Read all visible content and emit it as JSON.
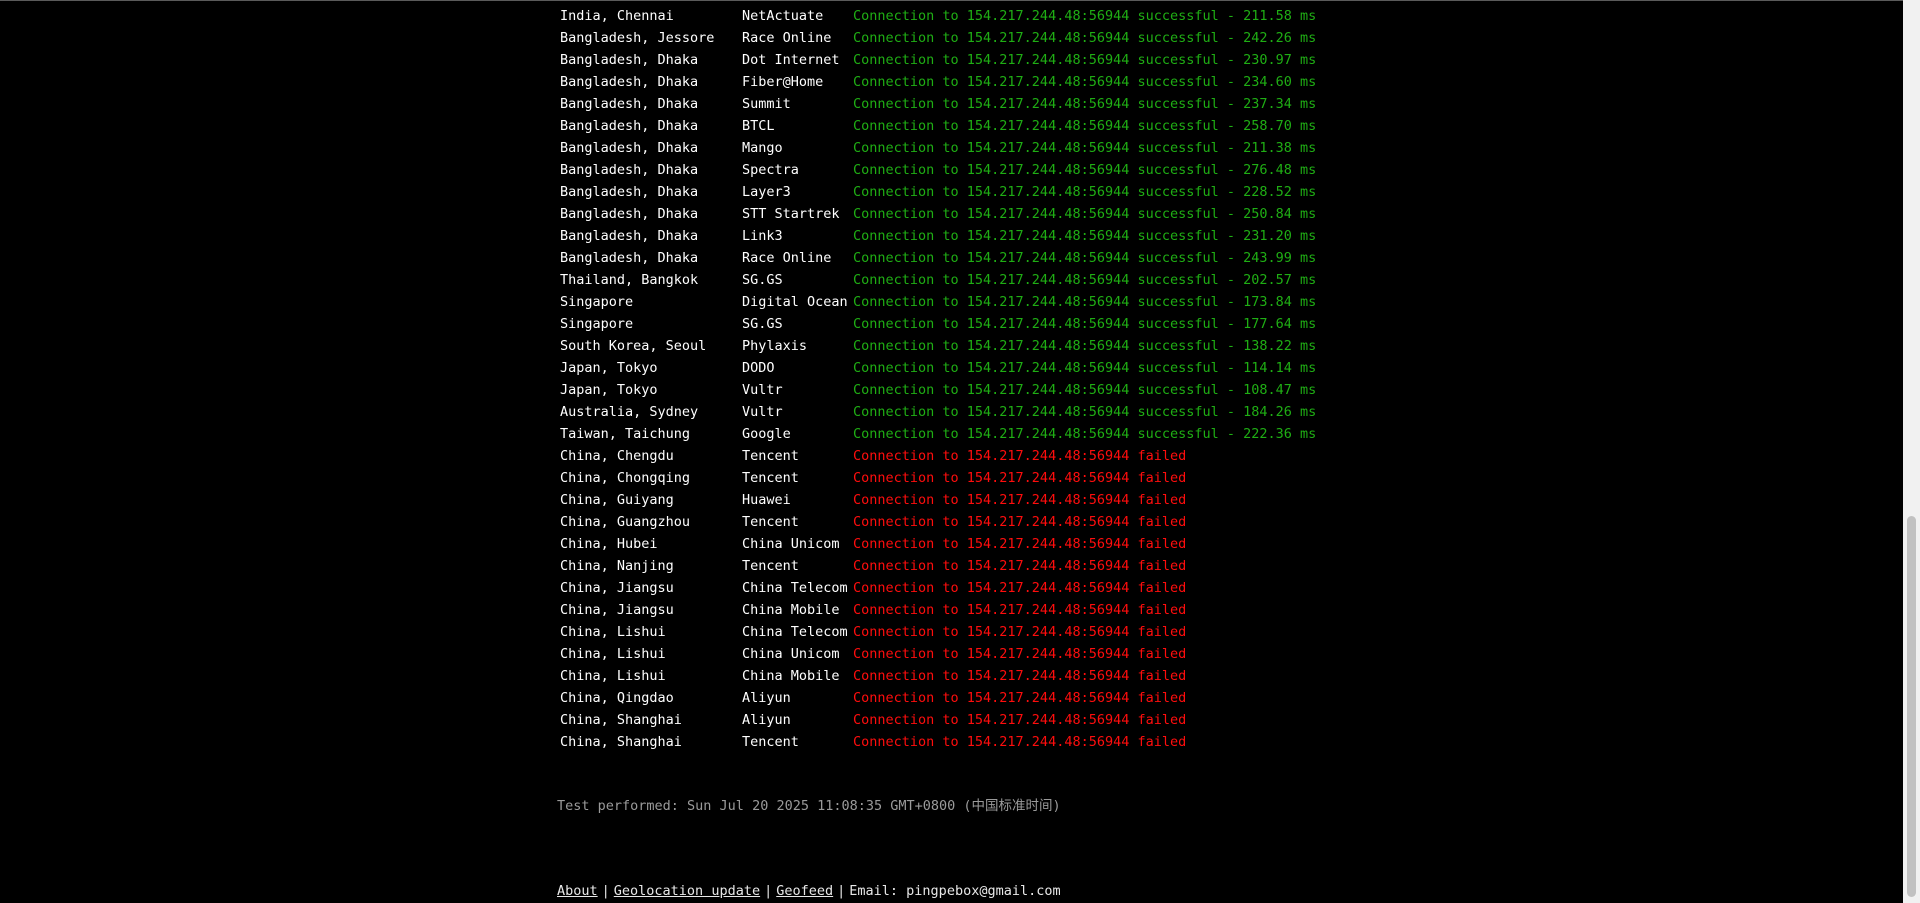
{
  "results": [
    {
      "location": "India, Chennai",
      "provider": "NetActuate",
      "status": "ok",
      "message": "Connection to 154.217.244.48:56944 successful - 211.58 ms"
    },
    {
      "location": "Bangladesh, Jessore",
      "provider": "Race Online",
      "status": "ok",
      "message": "Connection to 154.217.244.48:56944 successful - 242.26 ms"
    },
    {
      "location": "Bangladesh, Dhaka",
      "provider": "Dot Internet",
      "status": "ok",
      "message": "Connection to 154.217.244.48:56944 successful - 230.97 ms"
    },
    {
      "location": "Bangladesh, Dhaka",
      "provider": "Fiber@Home",
      "status": "ok",
      "message": "Connection to 154.217.244.48:56944 successful - 234.60 ms"
    },
    {
      "location": "Bangladesh, Dhaka",
      "provider": "Summit",
      "status": "ok",
      "message": "Connection to 154.217.244.48:56944 successful - 237.34 ms"
    },
    {
      "location": "Bangladesh, Dhaka",
      "provider": "BTCL",
      "status": "ok",
      "message": "Connection to 154.217.244.48:56944 successful - 258.70 ms"
    },
    {
      "location": "Bangladesh, Dhaka",
      "provider": "Mango",
      "status": "ok",
      "message": "Connection to 154.217.244.48:56944 successful - 211.38 ms"
    },
    {
      "location": "Bangladesh, Dhaka",
      "provider": "Spectra",
      "status": "ok",
      "message": "Connection to 154.217.244.48:56944 successful - 276.48 ms"
    },
    {
      "location": "Bangladesh, Dhaka",
      "provider": "Layer3",
      "status": "ok",
      "message": "Connection to 154.217.244.48:56944 successful - 228.52 ms"
    },
    {
      "location": "Bangladesh, Dhaka",
      "provider": "STT Startrek",
      "status": "ok",
      "message": "Connection to 154.217.244.48:56944 successful - 250.84 ms"
    },
    {
      "location": "Bangladesh, Dhaka",
      "provider": "Link3",
      "status": "ok",
      "message": "Connection to 154.217.244.48:56944 successful - 231.20 ms"
    },
    {
      "location": "Bangladesh, Dhaka",
      "provider": "Race Online",
      "status": "ok",
      "message": "Connection to 154.217.244.48:56944 successful - 243.99 ms"
    },
    {
      "location": "Thailand, Bangkok",
      "provider": "SG.GS",
      "status": "ok",
      "message": "Connection to 154.217.244.48:56944 successful - 202.57 ms"
    },
    {
      "location": "Singapore",
      "provider": "Digital Ocean",
      "status": "ok",
      "message": "Connection to 154.217.244.48:56944 successful - 173.84 ms"
    },
    {
      "location": "Singapore",
      "provider": "SG.GS",
      "status": "ok",
      "message": "Connection to 154.217.244.48:56944 successful - 177.64 ms"
    },
    {
      "location": "South Korea, Seoul",
      "provider": "Phylaxis",
      "status": "ok",
      "message": "Connection to 154.217.244.48:56944 successful - 138.22 ms"
    },
    {
      "location": "Japan, Tokyo",
      "provider": "DODO",
      "status": "ok",
      "message": "Connection to 154.217.244.48:56944 successful - 114.14 ms"
    },
    {
      "location": "Japan, Tokyo",
      "provider": "Vultr",
      "status": "ok",
      "message": "Connection to 154.217.244.48:56944 successful - 108.47 ms"
    },
    {
      "location": "Australia, Sydney",
      "provider": "Vultr",
      "status": "ok",
      "message": "Connection to 154.217.244.48:56944 successful - 184.26 ms"
    },
    {
      "location": "Taiwan, Taichung",
      "provider": "Google",
      "status": "ok",
      "message": "Connection to 154.217.244.48:56944 successful - 222.36 ms"
    },
    {
      "location": "China, Chengdu",
      "provider": "Tencent",
      "status": "fail",
      "message": "Connection to 154.217.244.48:56944 failed"
    },
    {
      "location": "China, Chongqing",
      "provider": "Tencent",
      "status": "fail",
      "message": "Connection to 154.217.244.48:56944 failed"
    },
    {
      "location": "China, Guiyang",
      "provider": "Huawei",
      "status": "fail",
      "message": "Connection to 154.217.244.48:56944 failed"
    },
    {
      "location": "China, Guangzhou",
      "provider": "Tencent",
      "status": "fail",
      "message": "Connection to 154.217.244.48:56944 failed"
    },
    {
      "location": "China, Hubei",
      "provider": "China Unicom",
      "status": "fail",
      "message": "Connection to 154.217.244.48:56944 failed"
    },
    {
      "location": "China, Nanjing",
      "provider": "Tencent",
      "status": "fail",
      "message": "Connection to 154.217.244.48:56944 failed"
    },
    {
      "location": "China, Jiangsu",
      "provider": "China Telecom",
      "status": "fail",
      "message": "Connection to 154.217.244.48:56944 failed"
    },
    {
      "location": "China, Jiangsu",
      "provider": "China Mobile",
      "status": "fail",
      "message": "Connection to 154.217.244.48:56944 failed"
    },
    {
      "location": "China, Lishui",
      "provider": "China Telecom",
      "status": "fail",
      "message": "Connection to 154.217.244.48:56944 failed"
    },
    {
      "location": "China, Lishui",
      "provider": "China Unicom",
      "status": "fail",
      "message": "Connection to 154.217.244.48:56944 failed"
    },
    {
      "location": "China, Lishui",
      "provider": "China Mobile",
      "status": "fail",
      "message": "Connection to 154.217.244.48:56944 failed"
    },
    {
      "location": "China, Qingdao",
      "provider": "Aliyun",
      "status": "fail",
      "message": "Connection to 154.217.244.48:56944 failed"
    },
    {
      "location": "China, Shanghai",
      "provider": "Aliyun",
      "status": "fail",
      "message": "Connection to 154.217.244.48:56944 failed"
    },
    {
      "location": "China, Shanghai",
      "provider": "Tencent",
      "status": "fail",
      "message": "Connection to 154.217.244.48:56944 failed"
    }
  ],
  "test_performed": "Test performed: Sun Jul 20 2025 11:08:35 GMT+0800 (中国标准时间)",
  "footer": {
    "about": "About",
    "sep1": "|",
    "geolocation_update": "Geolocation update",
    "sep2": "|",
    "geofeed": "Geofeed",
    "sep3": "|",
    "email": "Email: pingpebox@gmail.com"
  },
  "colors": {
    "background": "#000000",
    "success": "#1fae14",
    "failure": "#ff0d0d",
    "text": "#ffffff",
    "muted": "#9a9a9a"
  },
  "scroll": {
    "thumb_position_fraction": 0.57,
    "visible_fraction": 0.42
  }
}
